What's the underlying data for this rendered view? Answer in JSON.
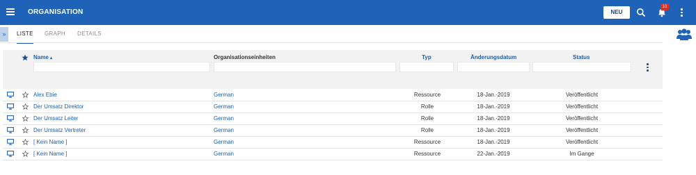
{
  "header": {
    "title": "ORGANISATION",
    "new_button": "NEU",
    "notification_count": "10",
    "bar_color": "#1e63b8"
  },
  "tabs": [
    {
      "label": "LISTE",
      "active": true
    },
    {
      "label": "GRAPH",
      "active": false
    },
    {
      "label": "DETAILS",
      "active": false
    }
  ],
  "table": {
    "columns": {
      "name": "Name",
      "org_units": "Organisationseinheiten",
      "type": "Typ",
      "changed": "Änderungsdatum",
      "status": "Status"
    },
    "sort": {
      "column": "name",
      "direction": "ascending",
      "indicator": "▴"
    },
    "rows": [
      {
        "name": "Alex Ebie",
        "org": "German",
        "type": "Ressource",
        "date": "18-Jan.-2019",
        "status": "Veröffentlicht"
      },
      {
        "name": "Der Umsatz Direktor",
        "org": "German",
        "type": "Rolle",
        "date": "18-Jan.-2019",
        "status": "Veröffentlicht"
      },
      {
        "name": "Der Umsatz Leiter",
        "org": "German",
        "type": "Rolle",
        "date": "18-Jan.-2019",
        "status": "Veröffentlicht"
      },
      {
        "name": "Der Umsatz Vertreter",
        "org": "German",
        "type": "Rolle",
        "date": "18-Jan.-2019",
        "status": "Veröffentlicht"
      },
      {
        "name": "[ Kein Name ]",
        "org": "German",
        "type": "Ressource",
        "date": "18-Jan.-2019",
        "status": "Veröffentlicht"
      },
      {
        "name": "[ Kein Name ]",
        "org": "German",
        "type": "Ressource",
        "date": "22-Jan.-2019",
        "status": "Im Gange"
      }
    ]
  },
  "icons": {
    "menu": "hamburger-menu-icon",
    "search": "search-icon",
    "notifications": "bell-icon",
    "more": "kebab-menu-icon",
    "sidebar": "double-chevron-right-icon",
    "users": "users-group-icon",
    "row_type": "monitor-icon",
    "favorite": "star-outline-icon"
  }
}
